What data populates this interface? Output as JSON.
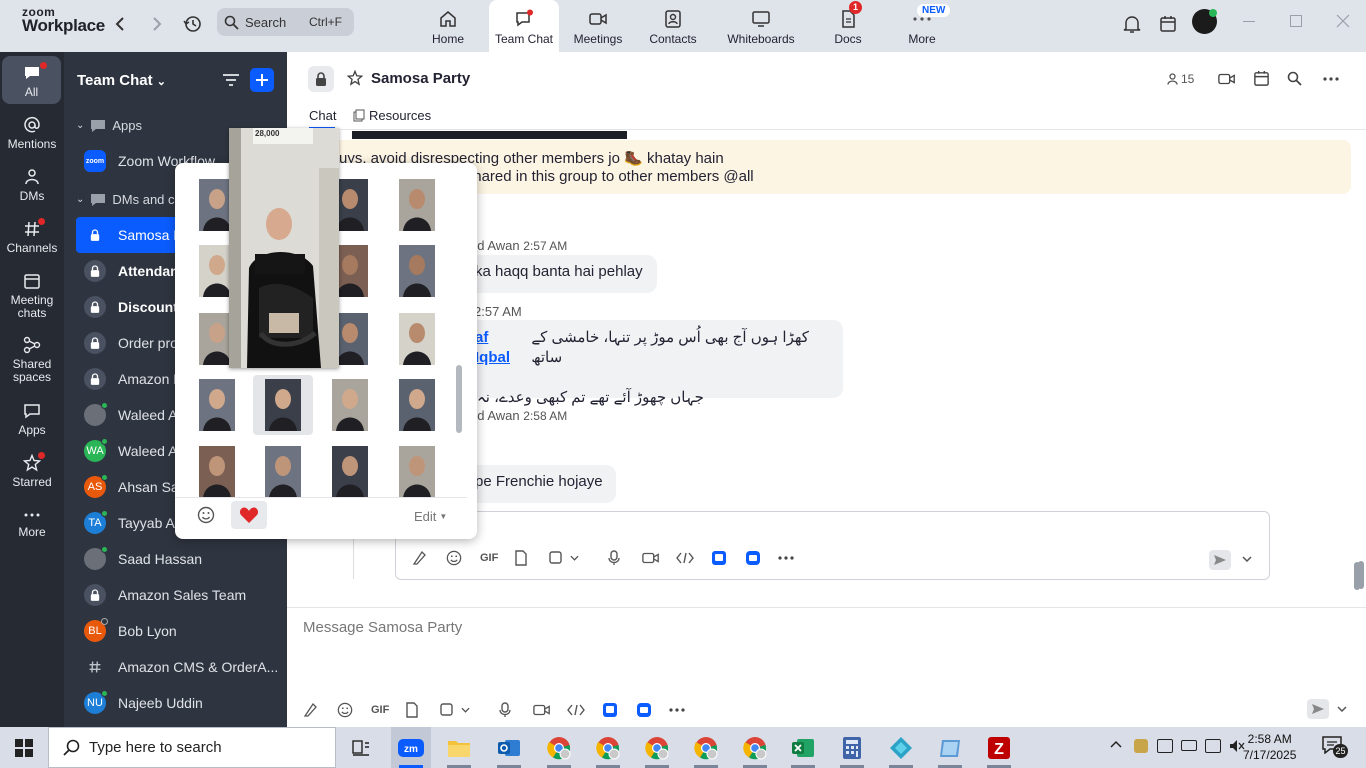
{
  "app": {
    "logo_line1": "zoom",
    "logo_line2": "Workplace"
  },
  "topbar": {
    "search_label": "Search",
    "search_shortcut": "Ctrl+F",
    "tabs": [
      {
        "label": "Home",
        "icon": "home-icon"
      },
      {
        "label": "Team Chat",
        "icon": "chat-icon"
      },
      {
        "label": "Meetings",
        "icon": "camera-icon"
      },
      {
        "label": "Contacts",
        "icon": "contact-icon"
      },
      {
        "label": "Whiteboards",
        "icon": "whiteboard-icon"
      },
      {
        "label": "Docs",
        "icon": "docs-icon",
        "badge": "1"
      },
      {
        "label": "More",
        "icon": "more-dots-icon",
        "badge": "NEW"
      }
    ]
  },
  "rail": {
    "items": [
      {
        "label": "All",
        "icon": "chat-bubble-icon"
      },
      {
        "label": "Mentions",
        "icon": "at-icon"
      },
      {
        "label": "DMs",
        "icon": "people-icon"
      },
      {
        "label": "Channels",
        "icon": "hash-icon"
      },
      {
        "label": "Meeting chats",
        "icon": "calendar-icon"
      },
      {
        "label": "Shared spaces",
        "icon": "share-icon"
      },
      {
        "label": "Apps",
        "icon": "apps-icon"
      },
      {
        "label": "Starred",
        "icon": "star-icon"
      },
      {
        "label": "More",
        "icon": "ellipsis-icon"
      }
    ]
  },
  "sidebar": {
    "title": "Team Chat",
    "section_apps": "Apps",
    "app_item": "Zoom Workflow",
    "section_dms": "DMs and ch",
    "items": [
      {
        "label": "Samosa P",
        "avatar": "lock",
        "active": true
      },
      {
        "label": "Attendan",
        "avatar": "lock",
        "bold": true
      },
      {
        "label": "Discount",
        "avatar": "lock",
        "bold": true
      },
      {
        "label": "Order pro",
        "avatar": "lock"
      },
      {
        "label": "Amazon P",
        "avatar": "lock"
      },
      {
        "label": "Waleed A",
        "avatar": "photo"
      },
      {
        "label": "Waleed A",
        "avatar": "WA",
        "color": "#2ab557"
      },
      {
        "label": "Ahsan Sac",
        "avatar": "AS",
        "color": "#e8590c"
      },
      {
        "label": "Tayyab As",
        "avatar": "TA",
        "color": "#1c7ed6"
      },
      {
        "label": "Saad Hassan",
        "avatar": "photo"
      },
      {
        "label": "Amazon Sales Team",
        "avatar": "lock"
      },
      {
        "label": "Bob Lyon",
        "avatar": "BL",
        "color": "#e8590c"
      },
      {
        "label": "Amazon CMS & OrderA...",
        "avatar": "hash"
      },
      {
        "label": "Najeeb Uddin",
        "avatar": "NU",
        "color": "#1c7ed6"
      }
    ]
  },
  "channel": {
    "name": "Samosa Party",
    "members": "15",
    "tabs": [
      "Chat",
      "Resources"
    ]
  },
  "messages": {
    "banner_line1": "uys, avoid disrespecting other members jo 🥾 khatay hain",
    "banner_line2": "ny picture and vdo shared in this group to other members @all",
    "m1_sender": "ed Awan",
    "m1_time": "2:57 AM",
    "m1_text": "ka haqq banta hai pehlay",
    "m2_time": "2:57 AM",
    "m2_mention": "af Iqbal",
    "m2_line1": "کھڑا ہوں آج بھی اُس موڑ پر تنہا، خامشی کے ساتھ",
    "m2_line2": "جہاں چھوڑ آئے تھے تم کبھی وعدے، نہ",
    "m3_sender": "ed Awan",
    "m3_time": "2:58 AM",
    "m3_text": "pe Frenchie hojaye"
  },
  "composer": {
    "placeholder": "Message Samosa Party",
    "gif_label": "GIF"
  },
  "picker": {
    "edit_label": "Edit",
    "preview_sign": "28,000"
  },
  "taskbar": {
    "search_placeholder": "Type here to search",
    "time": "2:58 AM",
    "date": "7/17/2025",
    "notifications": "25"
  }
}
